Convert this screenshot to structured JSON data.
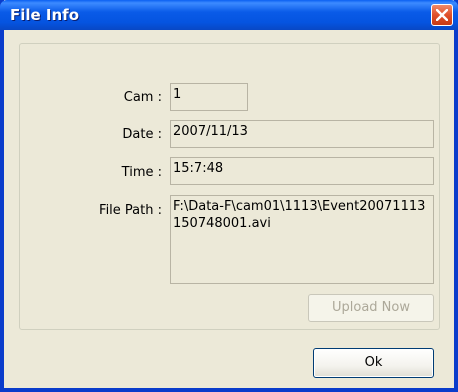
{
  "window": {
    "title": "File Info"
  },
  "fields": {
    "cam_label": "Cam :",
    "cam_value": "1",
    "date_label": "Date :",
    "date_value": "2007/11/13",
    "time_label": "Time :",
    "time_value": "15:7:48",
    "path_label": "File Path :",
    "path_value": "F:\\Data-F\\cam01\\1113\\Event20071113150748001.avi"
  },
  "buttons": {
    "upload_label": "Upload Now",
    "ok_label": "Ok"
  },
  "icons": {
    "close": "close-icon"
  },
  "colors": {
    "titlebar": "#0A5BE8",
    "dialog_background": "#ECE9D8",
    "close_button": "#E0502A"
  }
}
